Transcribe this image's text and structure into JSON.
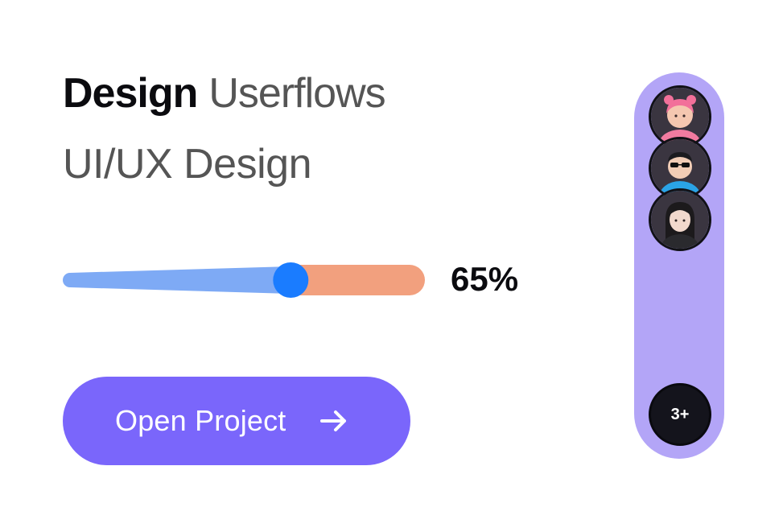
{
  "project": {
    "title_strong": "Design",
    "title_light": "Userflows",
    "category": "UI/UX Design"
  },
  "progress": {
    "value": 0.65,
    "label": "65%",
    "colors": {
      "filled": "#7eaaf5",
      "remaining": "#f2a07e",
      "thumb": "#1a7cff"
    }
  },
  "actions": {
    "open_label": "Open Project",
    "open_icon": "arrow-right-icon",
    "button_color": "#7a66fb"
  },
  "members": {
    "panel_color": "#b3a5f7",
    "avatars": [
      {
        "name": "avatar-pink-hair",
        "icon": "person-avatar-icon"
      },
      {
        "name": "avatar-sunglasses",
        "icon": "person-avatar-icon"
      },
      {
        "name": "avatar-dark-hair",
        "icon": "person-avatar-icon"
      }
    ],
    "more_label": "3+"
  }
}
